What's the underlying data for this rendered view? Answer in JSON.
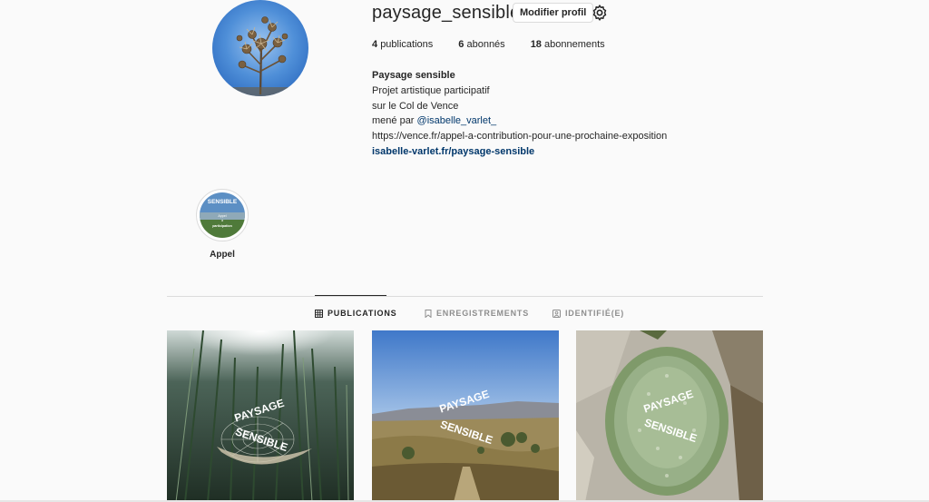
{
  "profile": {
    "username": "paysage_sensible",
    "edit_label": "Modifier profil",
    "stats": {
      "posts_count": "4",
      "posts_label": "publications",
      "followers_count": "6",
      "followers_label": "abonnés",
      "following_count": "18",
      "following_label": "abonnements"
    },
    "bio": {
      "name": "Paysage sensible",
      "line1": "Projet artistique participatif",
      "line2": "sur le Col de Vence",
      "line3_prefix": "mené par ",
      "mention": "@isabelle_varlet_",
      "url_text": "https://vence.fr/appel-a-contribution-pour-une-prochaine-exposition",
      "website": "isabelle-varlet.fr/paysage-sensible"
    }
  },
  "highlights": [
    {
      "label": "Appel",
      "image_text_top": "SENSIBLE",
      "image_text_mid": "Appel",
      "image_text_mid2": "à",
      "image_text_bottom": "participation"
    }
  ],
  "tabs": [
    {
      "label": "PUBLICATIONS",
      "icon": "grid-icon",
      "active": true
    },
    {
      "label": "ENREGISTREMENTS",
      "icon": "bookmark-icon",
      "active": false
    },
    {
      "label": "IDENTIFIÉ(E)",
      "icon": "tagged-icon",
      "active": false
    }
  ],
  "posts": [
    {
      "overlay_top": "PAYSAGE",
      "overlay_bottom": "SENSIBLE"
    },
    {
      "overlay_top": "PAYSAGE",
      "overlay_bottom": "SENSIBLE"
    },
    {
      "overlay_top": "PAYSAGE",
      "overlay_bottom": "SENSIBLE"
    }
  ],
  "colors": {
    "background": "#fafafa",
    "text": "#262626",
    "muted": "#8e8e8e",
    "link": "#00376b",
    "border": "#dbdbdb"
  }
}
